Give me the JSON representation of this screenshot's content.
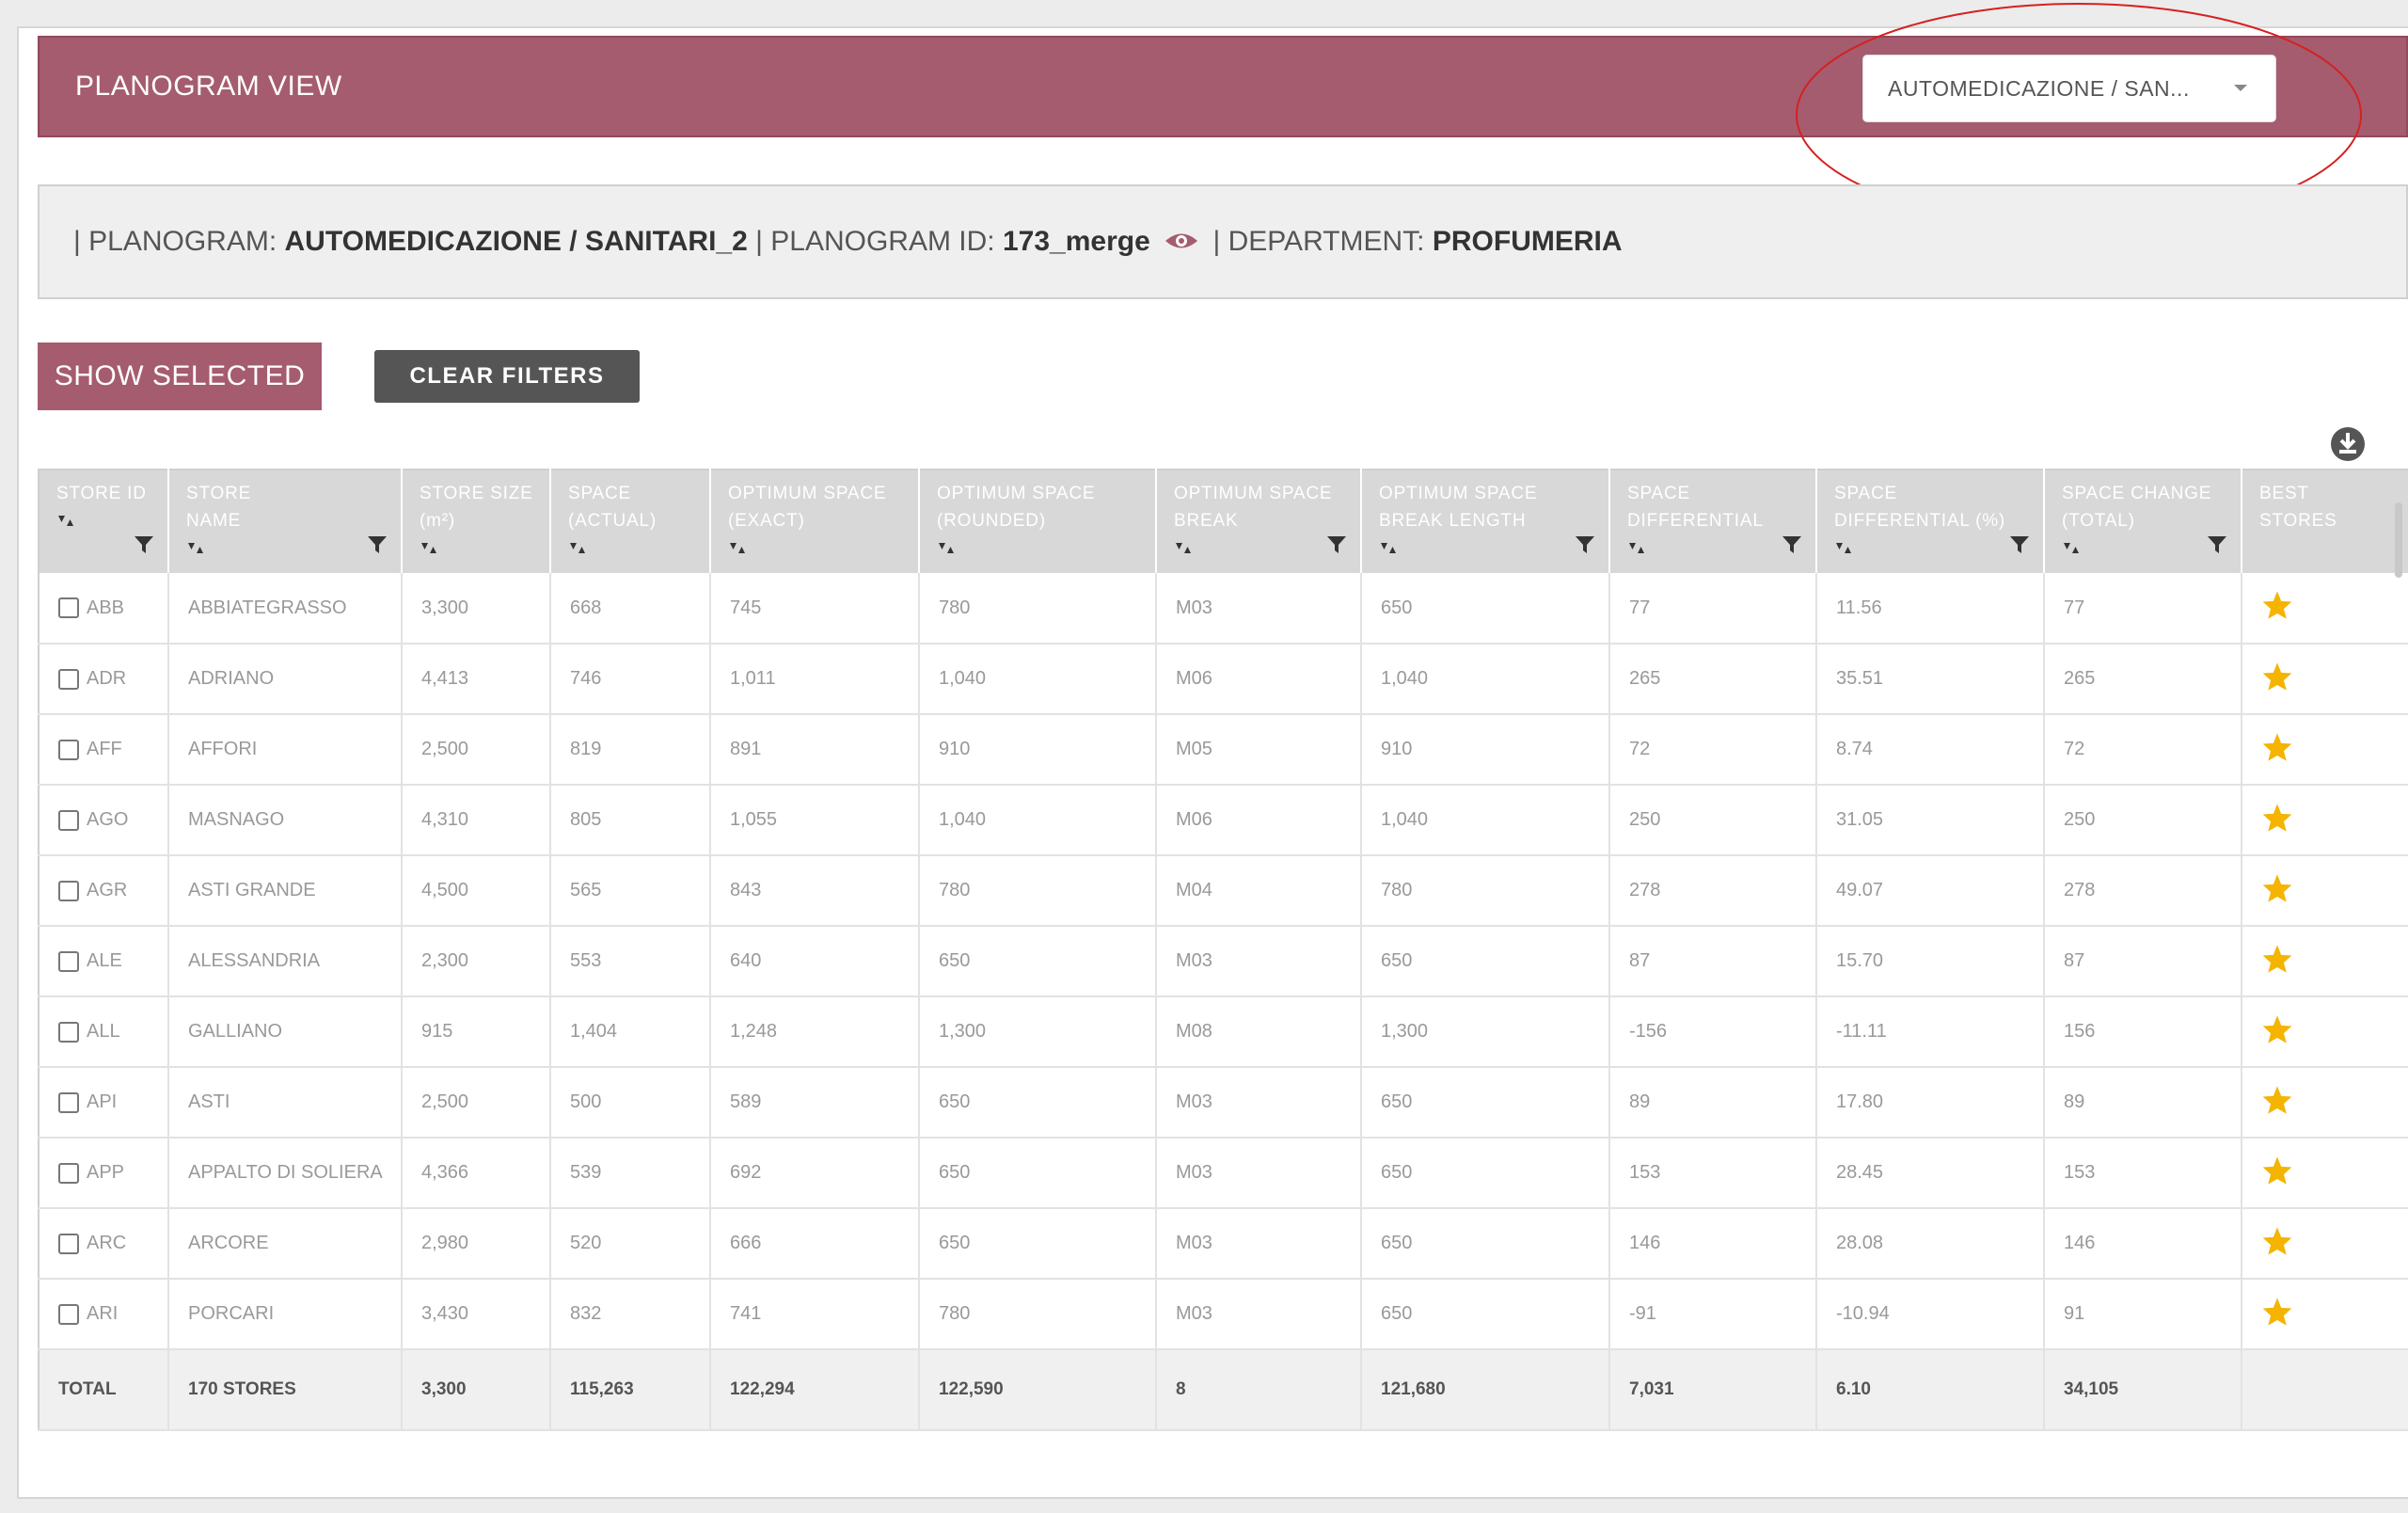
{
  "header": {
    "title": "PLANOGRAM VIEW",
    "selected_planogram": "AUTOMEDICAZIONE / SAN..."
  },
  "info": {
    "planogram_label": "| PLANOGRAM:",
    "planogram_value": "AUTOMEDICAZIONE / SANITARI_2",
    "id_label": "| PLANOGRAM ID:",
    "id_value": "173_merge",
    "dept_label": "| DEPARTMENT:",
    "dept_value": "PROFUMERIA"
  },
  "buttons": {
    "show_selected": "SHOW SELECTED",
    "clear_filters": "CLEAR FILTERS"
  },
  "colors": {
    "accent": "#a55c6f",
    "star": "#f4b400",
    "annotation": "#d62020"
  },
  "icons": [
    "eye-icon",
    "download-icon",
    "sort-icon",
    "filter-icon",
    "star-icon",
    "chevron-down-icon"
  ],
  "table": {
    "columns": [
      {
        "line1": "STORE ID",
        "line2": "",
        "filter": true
      },
      {
        "line1": "STORE",
        "line2": "NAME",
        "filter": true
      },
      {
        "line1": "STORE SIZE",
        "line2": "(m²)",
        "filter": false
      },
      {
        "line1": "SPACE",
        "line2": "(ACTUAL)",
        "filter": false
      },
      {
        "line1": "OPTIMUM SPACE",
        "line2": "(EXACT)",
        "filter": false
      },
      {
        "line1": "OPTIMUM SPACE",
        "line2": "(ROUNDED)",
        "filter": false
      },
      {
        "line1": "OPTIMUM SPACE",
        "line2": "BREAK",
        "filter": true
      },
      {
        "line1": "OPTIMUM SPACE",
        "line2": "BREAK LENGTH",
        "filter": true
      },
      {
        "line1": "SPACE",
        "line2": "DIFFERENTIAL",
        "filter": true
      },
      {
        "line1": "SPACE",
        "line2": "DIFFERENTIAL (%)",
        "filter": true
      },
      {
        "line1": "SPACE CHANGE",
        "line2": "(TOTAL)",
        "filter": true
      },
      {
        "line1": "BEST",
        "line2": "STORES",
        "filter": false
      }
    ],
    "rows": [
      [
        "ABB",
        "ABBIATEGRASSO",
        "3,300",
        "668",
        "745",
        "780",
        "M03",
        "650",
        "77",
        "11.56",
        "77"
      ],
      [
        "ADR",
        "ADRIANO",
        "4,413",
        "746",
        "1,011",
        "1,040",
        "M06",
        "1,040",
        "265",
        "35.51",
        "265"
      ],
      [
        "AFF",
        "AFFORI",
        "2,500",
        "819",
        "891",
        "910",
        "M05",
        "910",
        "72",
        "8.74",
        "72"
      ],
      [
        "AGO",
        "MASNAGO",
        "4,310",
        "805",
        "1,055",
        "1,040",
        "M06",
        "1,040",
        "250",
        "31.05",
        "250"
      ],
      [
        "AGR",
        "ASTI GRANDE",
        "4,500",
        "565",
        "843",
        "780",
        "M04",
        "780",
        "278",
        "49.07",
        "278"
      ],
      [
        "ALE",
        "ALESSANDRIA",
        "2,300",
        "553",
        "640",
        "650",
        "M03",
        "650",
        "87",
        "15.70",
        "87"
      ],
      [
        "ALL",
        "GALLIANO",
        "915",
        "1,404",
        "1,248",
        "1,300",
        "M08",
        "1,300",
        "-156",
        "-11.11",
        "156"
      ],
      [
        "API",
        "ASTI",
        "2,500",
        "500",
        "589",
        "650",
        "M03",
        "650",
        "89",
        "17.80",
        "89"
      ],
      [
        "APP",
        "APPALTO DI SOLIERA",
        "4,366",
        "539",
        "692",
        "650",
        "M03",
        "650",
        "153",
        "28.45",
        "153"
      ],
      [
        "ARC",
        "ARCORE",
        "2,980",
        "520",
        "666",
        "650",
        "M03",
        "650",
        "146",
        "28.08",
        "146"
      ],
      [
        "ARI",
        "PORCARI",
        "3,430",
        "832",
        "741",
        "780",
        "M03",
        "650",
        "-91",
        "-10.94",
        "91"
      ]
    ],
    "total": [
      "TOTAL",
      "170 STORES",
      "3,300",
      "115,263",
      "122,294",
      "122,590",
      "8",
      "121,680",
      "7,031",
      "6.10",
      "34,105",
      ""
    ]
  }
}
